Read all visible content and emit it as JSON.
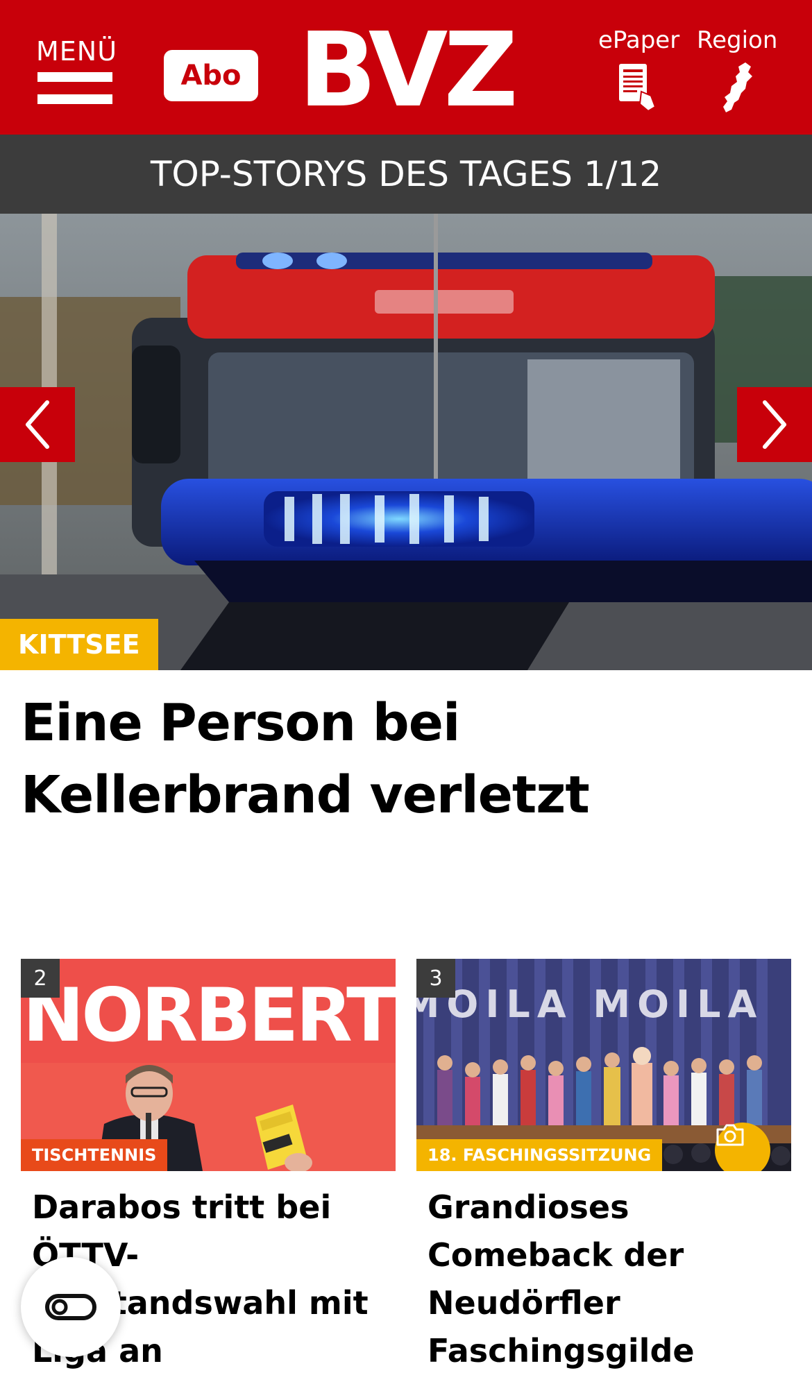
{
  "header": {
    "menu_label": "MENÜ",
    "abo_label": "Abo",
    "logo": "BVZ",
    "epaper_label": "ePaper",
    "region_label": "Region",
    "brand_color": "#c8000a"
  },
  "topbar": {
    "label": "TOP-STORYS DES TAGES 1/12"
  },
  "hero": {
    "tag": "KITTSEE",
    "title": "Eine Person bei Kellerbrand verletzt",
    "prev_icon": "chevron-left-icon",
    "next_icon": "chevron-right-icon"
  },
  "cards": [
    {
      "number": "2",
      "image_text": "NORBERT",
      "tag": "TISCHTENNIS",
      "title": "Darabos tritt bei ÖTTV-Vorstandswahl mit Liga an",
      "tag_color": "#e84a1a"
    },
    {
      "number": "3",
      "image_text": "MOILA MOILA",
      "tag": "18. FASCHINGSSITZUNG",
      "title": "Grandioses Comeback der Neudörfler Faschingsgilde „Moila Zwoa“",
      "tag_color": "#f4b400",
      "gallery_icon": "camera-icon"
    }
  ],
  "floating_button": {
    "icon": "reader-toggle-icon"
  }
}
